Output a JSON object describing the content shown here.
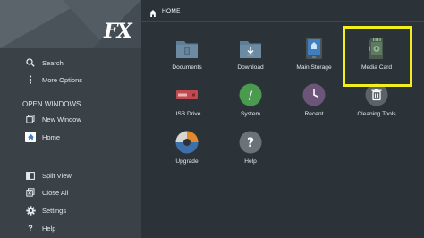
{
  "brand": {
    "logo_text": "FX"
  },
  "header": {
    "breadcrumb": "HOME"
  },
  "sidebar": {
    "top_items": [
      {
        "label": "Search",
        "icon": "search-icon"
      },
      {
        "label": "More Options",
        "icon": "more-vertical-icon"
      }
    ],
    "open_windows_heading": "OPEN WINDOWS",
    "window_items": [
      {
        "label": "New Window",
        "icon": "new-window-icon"
      },
      {
        "label": "Home",
        "icon": "home-icon"
      }
    ],
    "bottom_items": [
      {
        "label": "Split View",
        "icon": "split-view-icon"
      },
      {
        "label": "Close All",
        "icon": "close-all-icon"
      },
      {
        "label": "Settings",
        "icon": "gear-icon"
      },
      {
        "label": "Help",
        "icon": "help-icon"
      }
    ]
  },
  "tiles": [
    {
      "label": "Documents",
      "icon": "documents-folder-icon"
    },
    {
      "label": "Download",
      "icon": "download-folder-icon"
    },
    {
      "label": "Main Storage",
      "icon": "main-storage-icon"
    },
    {
      "label": "Media Card",
      "icon": "media-card-icon"
    },
    {
      "label": "USB Drive",
      "icon": "usb-drive-icon"
    },
    {
      "label": "System",
      "icon": "system-icon"
    },
    {
      "label": "Recent",
      "icon": "recent-icon"
    },
    {
      "label": "Cleaning Tools",
      "icon": "trash-icon"
    },
    {
      "label": "Upgrade",
      "icon": "upgrade-icon"
    },
    {
      "label": "Help",
      "icon": "help-icon"
    }
  ],
  "colors": {
    "highlight": "#f3ef1e",
    "folder": "#6d8aa3",
    "system_green": "#4a9a4f",
    "recent_purple": "#6b5579",
    "usb_red": "#c04a4f",
    "storage_blue": "#3f7fc1"
  }
}
